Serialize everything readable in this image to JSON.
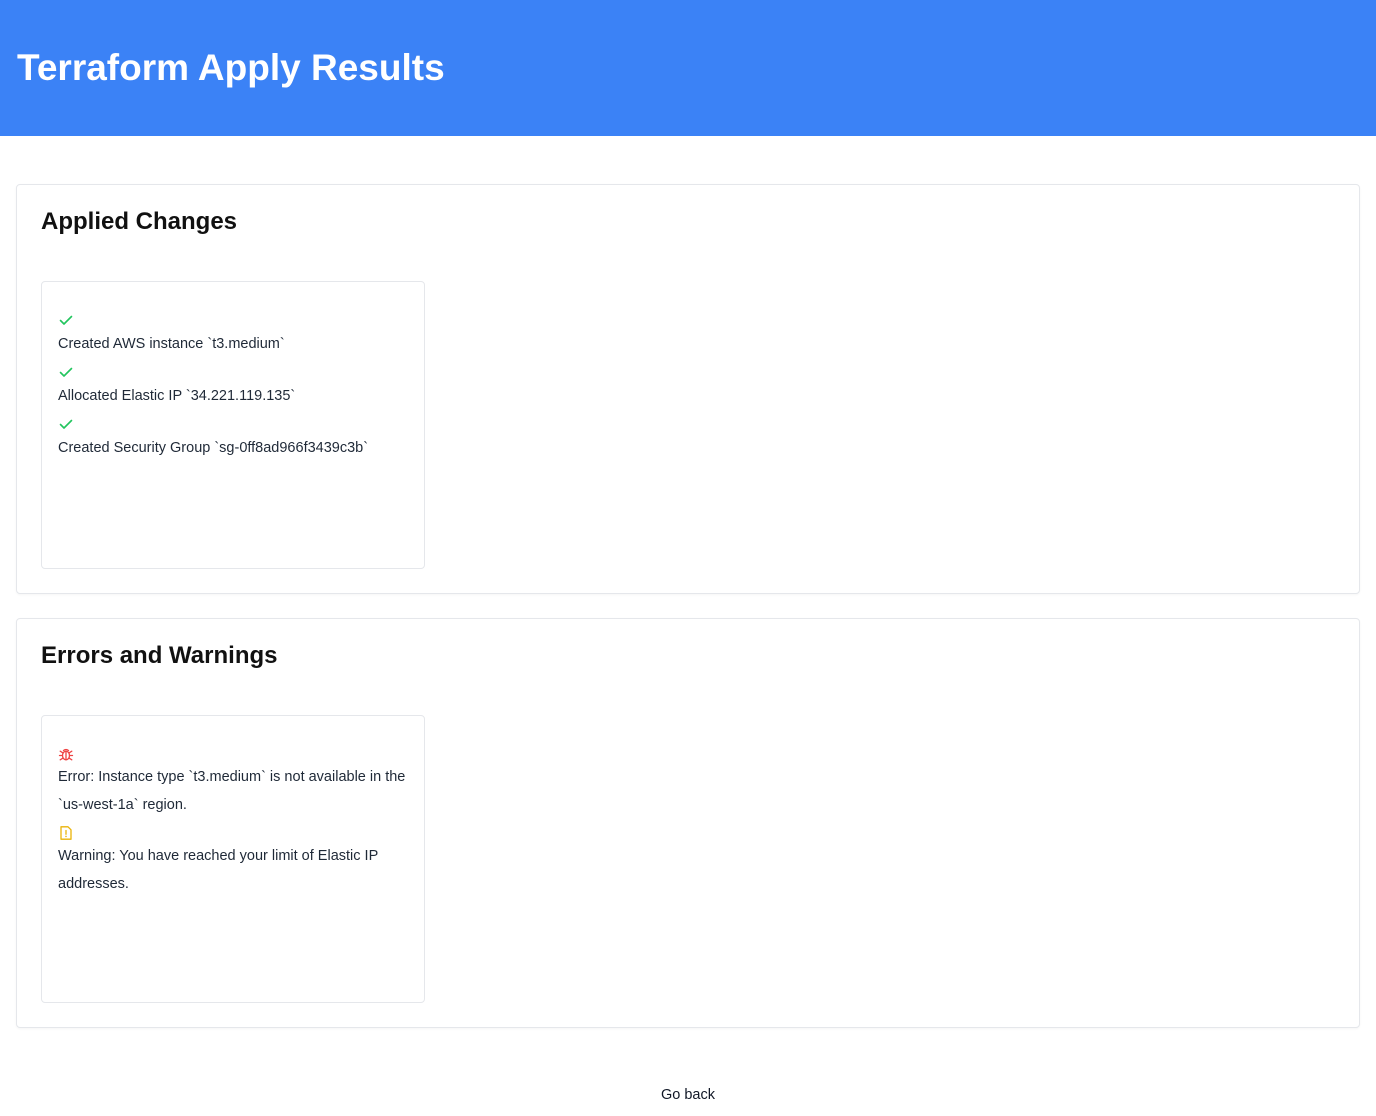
{
  "header": {
    "title": "Terraform Apply Results",
    "background_color": "#3b82f6"
  },
  "applied": {
    "title": "Applied Changes",
    "items": [
      {
        "icon": "check-icon",
        "text": "Created AWS instance `t3.medium`"
      },
      {
        "icon": "check-icon",
        "text": "Allocated Elastic IP `34.221.119.135`"
      },
      {
        "icon": "check-icon",
        "text": "Created Security Group `sg-0ff8ad966f3439c3b`"
      }
    ],
    "icon_color": "#22c55e"
  },
  "errors": {
    "title": "Errors and Warnings",
    "items": [
      {
        "icon": "bug-icon",
        "text": "Error: Instance type `t3.medium` is not available in the `us-west-1a` region.",
        "color": "#ef4444"
      },
      {
        "icon": "warning-file-icon",
        "text": "Warning: You have reached your limit of Elastic IP addresses.",
        "color": "#eab308"
      }
    ]
  },
  "footer": {
    "go_back_label": "Go back"
  }
}
